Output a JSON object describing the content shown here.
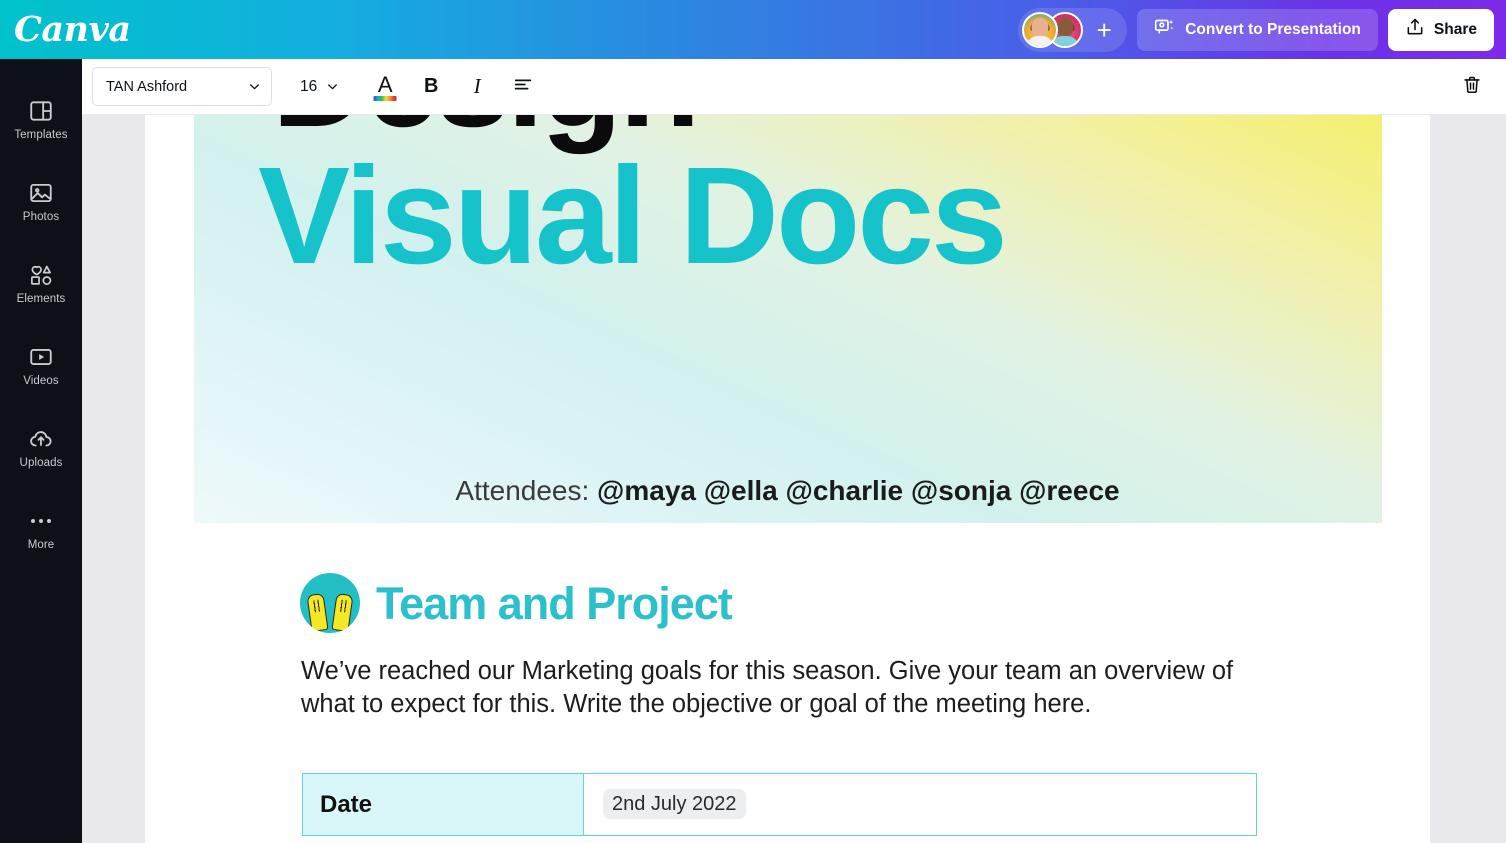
{
  "header": {
    "logo_text": "Canva",
    "add_member_label": "+",
    "convert_button": "Convert to Presentation",
    "share_button": "Share",
    "convert_icon": "magic-presentation-icon",
    "share_icon": "upload-icon",
    "gradient_start": "#00c2cb",
    "gradient_end": "#7d2ae8"
  },
  "sidebar": {
    "items": [
      {
        "label": "Templates",
        "icon": "templates-icon"
      },
      {
        "label": "Photos",
        "icon": "photo-icon"
      },
      {
        "label": "Elements",
        "icon": "shapes-icon"
      },
      {
        "label": "Videos",
        "icon": "video-icon"
      },
      {
        "label": "Uploads",
        "icon": "cloud-upload-icon"
      },
      {
        "label": "More",
        "icon": "ellipsis-icon"
      }
    ]
  },
  "toolbar": {
    "font_family_value": "TAN Ashford",
    "font_size_value": "16",
    "text_color_label": "A",
    "bold_label": "B",
    "italic_label": "I",
    "align_icon": "text-align-left-icon",
    "delete_icon": "trash-icon",
    "font_dropdown_icon": "chevron-down-icon",
    "size_dropdown_icon": "chevron-down-icon",
    "text_color_swatch": "rainbow-gradient"
  },
  "document": {
    "banner": {
      "line1": "Design",
      "line2": "Visual Docs",
      "line1_color": "#0b0b0b",
      "line2_color": "#17c3cb",
      "gradient_from": "#f6ef5e",
      "gradient_to": "#eef9fb"
    },
    "attendees": {
      "label": "Attendees: ",
      "names": "@maya @ella @charlie @sonja @reece"
    },
    "section": {
      "icon": "raising-hands-icon",
      "title": "Team and Project",
      "title_color": "#2cc0cc",
      "paragraph": "We’ve reached our Marketing goals for this season. Give your team an overview of what to expect for this. Write the objective or goal of the meeting here."
    },
    "table": {
      "rows": [
        {
          "key": "Date",
          "value": "2nd July 2022"
        }
      ],
      "border_color": "#5fd4dd",
      "key_cell_bg": "#d9f6f8"
    }
  }
}
